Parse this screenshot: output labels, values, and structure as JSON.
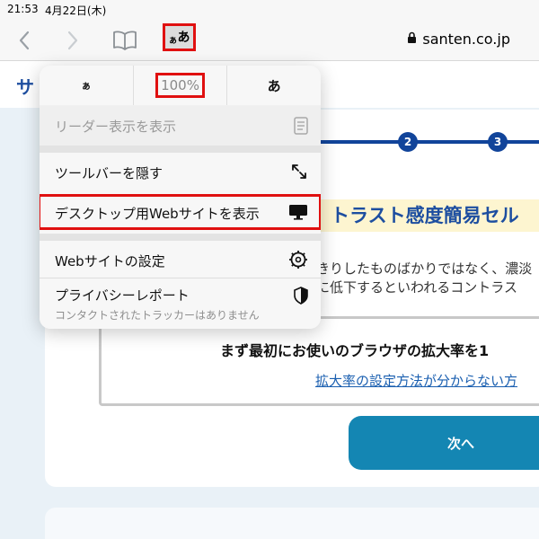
{
  "status_bar": {
    "time": "21:53",
    "date": "4月22日(木)"
  },
  "toolbar": {
    "text_size_button": {
      "small": "ぁ",
      "large": "あ"
    },
    "url": "santen.co.jp",
    "icons": [
      "back-icon",
      "forward-icon",
      "bookmarks-icon",
      "lock-icon"
    ]
  },
  "page": {
    "header_text": "サ",
    "steps": [
      "2",
      "3"
    ],
    "title": "トラスト感度簡易セル",
    "body_line1": "きりしたものばかりではなく、濃淡",
    "body_line2": "に低下するといわれるコントラス",
    "notice_text": "まず最初にお使いのブラウザの拡大率を1",
    "notice_link": "拡大率の設定方法が分からない方",
    "next_button": "次へ",
    "accent_color": "#1486b3",
    "brand_color": "#1d4ea0"
  },
  "menu": {
    "zoom": {
      "decrease": "ぁ",
      "level": "100%",
      "increase": "あ"
    },
    "items": [
      {
        "label": "リーダー表示を表示",
        "icon": "reader-icon",
        "enabled": false
      },
      {
        "label": "ツールバーを隠す",
        "icon": "expand-arrows-icon",
        "enabled": true
      },
      {
        "label": "デスクトップ用Webサイトを表示",
        "icon": "monitor-icon",
        "enabled": true
      },
      {
        "label": "Webサイトの設定",
        "icon": "gear-icon",
        "enabled": true
      },
      {
        "label": "プライバシーレポート",
        "sublabel": "コンタクトされたトラッカーはありません",
        "icon": "shield-icon",
        "enabled": true
      }
    ]
  },
  "highlight_color": "#e01010"
}
